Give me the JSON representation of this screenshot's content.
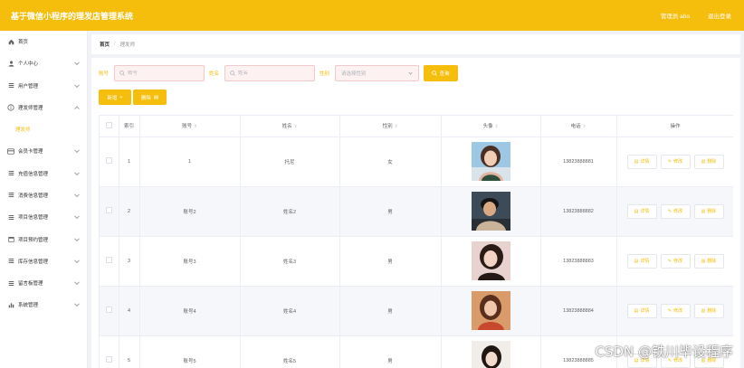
{
  "header": {
    "title": "基于微信小程序的理发店管理系统",
    "role_text": "管理员 abo",
    "logout_label": "退出登录",
    "bg_color": "#f5bd0c"
  },
  "sidebar": {
    "items": [
      {
        "label": "首页",
        "icon": "home-icon",
        "expandable": false
      },
      {
        "label": "个人中心",
        "icon": "user-icon",
        "expandable": true
      },
      {
        "label": "用户管理",
        "icon": "menu-icon",
        "expandable": true
      },
      {
        "label": "理发师管理",
        "icon": "info-icon",
        "expandable": true,
        "expanded": true
      },
      {
        "label": "会员卡管理",
        "icon": "card-icon",
        "expandable": true
      },
      {
        "label": "充值信息管理",
        "icon": "list-icon",
        "expandable": true
      },
      {
        "label": "消费信息管理",
        "icon": "list-icon",
        "expandable": true
      },
      {
        "label": "项目信息管理",
        "icon": "list-icon",
        "expandable": true
      },
      {
        "label": "项目预约管理",
        "icon": "calendar-icon",
        "expandable": true
      },
      {
        "label": "库存信息管理",
        "icon": "list-icon",
        "expandable": true
      },
      {
        "label": "留言板管理",
        "icon": "list-icon",
        "expandable": true
      },
      {
        "label": "系统管理",
        "icon": "chart-icon",
        "expandable": true
      }
    ],
    "submenu_active": "理发师"
  },
  "breadcrumb": {
    "home": "首页",
    "separator": "/",
    "current": "理发师"
  },
  "search": {
    "account_label": "账号",
    "account_placeholder": "账号",
    "name_label": "姓名",
    "name_placeholder": "姓名",
    "gender_label": "性别",
    "gender_placeholder": "请选择性别",
    "query_label": "查询"
  },
  "actions": {
    "add_label": "新增",
    "delete_label": "删除"
  },
  "table": {
    "headers": {
      "index": "索引",
      "account": "账号",
      "name": "姓名",
      "gender": "性别",
      "avatar": "头像",
      "phone": "电话",
      "ops": "操作"
    },
    "op_labels": {
      "detail": "详情",
      "edit": "修改",
      "delete": "删除"
    },
    "rows": [
      {
        "index": "1",
        "account": "1",
        "name": "托尼",
        "gender": "女",
        "phone": "13823888881"
      },
      {
        "index": "2",
        "account": "账号2",
        "name": "姓名2",
        "gender": "男",
        "phone": "13823888882"
      },
      {
        "index": "3",
        "account": "账号3",
        "name": "姓名3",
        "gender": "男",
        "phone": "13823888883"
      },
      {
        "index": "4",
        "account": "账号4",
        "name": "姓名4",
        "gender": "男",
        "phone": "13823888884"
      },
      {
        "index": "5",
        "account": "账号5",
        "name": "姓名5",
        "gender": "男",
        "phone": "13823888885"
      }
    ]
  },
  "watermark": "CSDN @铁川毕设程序"
}
